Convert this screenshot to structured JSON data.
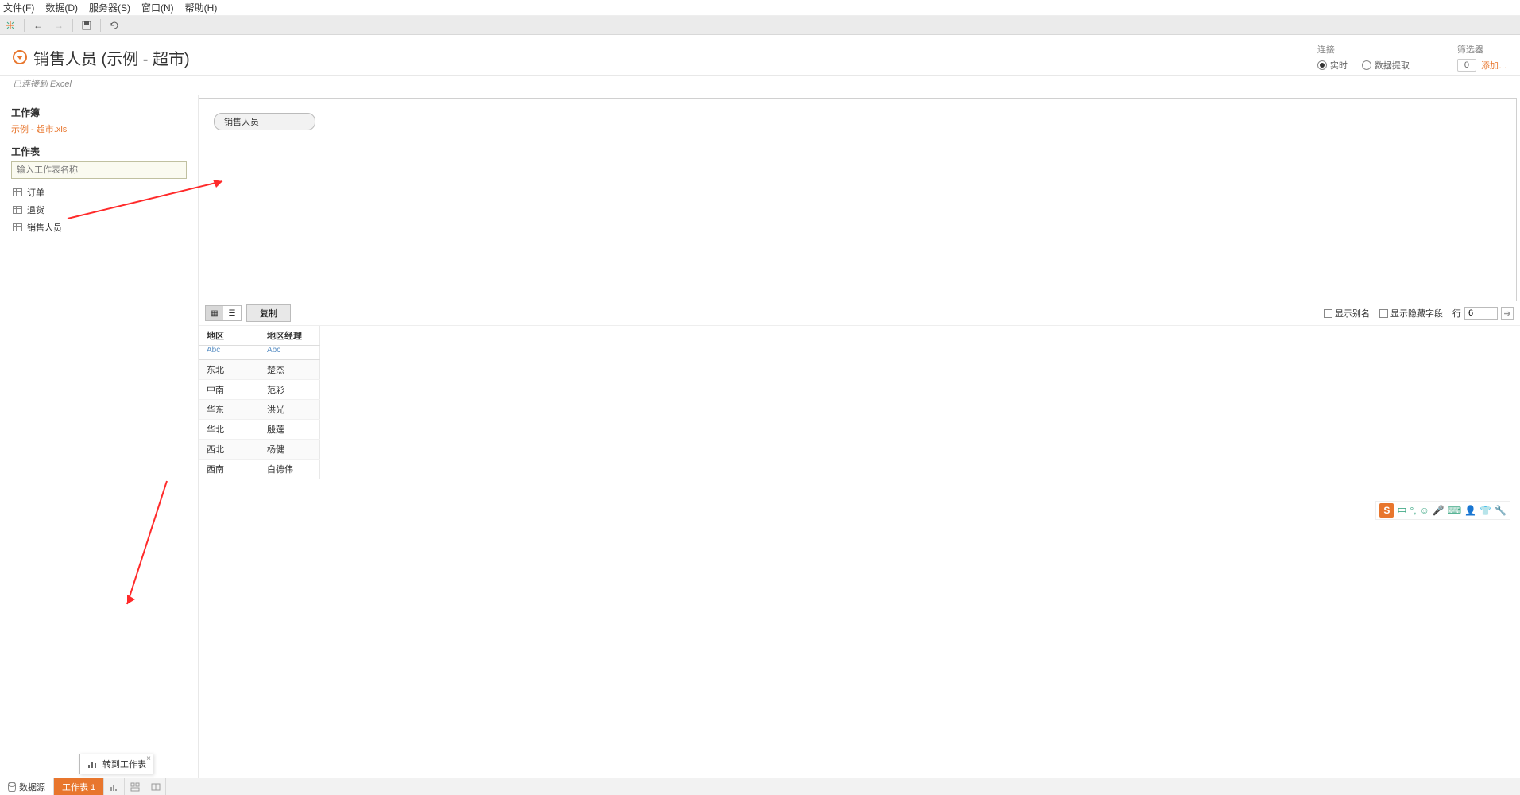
{
  "menu": {
    "file": "文件(F)",
    "data": "数据(D)",
    "server": "服务器(S)",
    "window": "窗口(N)",
    "help": "帮助(H)"
  },
  "header": {
    "title": "销售人员 (示例 - 超市)",
    "connected": "已连接到 Excel",
    "connection_label": "连接",
    "radio_live": "实时",
    "radio_extract": "数据提取",
    "filter_label": "筛选器",
    "filter_count": "0",
    "add_link": "添加…"
  },
  "sidebar": {
    "workbook_label": "工作簿",
    "file_name": "示例 - 超市.xls",
    "sheets_label": "工作表",
    "search_placeholder": "输入工作表名称",
    "sheets": [
      "订单",
      "退货",
      "销售人员"
    ]
  },
  "canvas": {
    "pill": "销售人员"
  },
  "grid_toolbar": {
    "copy": "复制",
    "show_alias": "显示别名",
    "show_hidden": "显示隐藏字段",
    "rows_label": "行",
    "rows_value": "6"
  },
  "grid": {
    "columns": [
      {
        "name": "地区",
        "type": "Abc"
      },
      {
        "name": "地区经理",
        "type": "Abc"
      }
    ],
    "rows": [
      [
        "东北",
        "楚杰"
      ],
      [
        "中南",
        "范彩"
      ],
      [
        "华东",
        "洪光"
      ],
      [
        "华北",
        "殷莲"
      ],
      [
        "西北",
        "杨健"
      ],
      [
        "西南",
        "白德伟"
      ]
    ]
  },
  "bottom": {
    "datasource": "数据源",
    "sheet1": "工作表 1",
    "tooltip": "转到工作表"
  },
  "ime": {
    "logo": "S",
    "lang": "中"
  }
}
